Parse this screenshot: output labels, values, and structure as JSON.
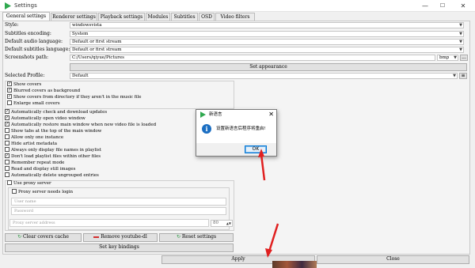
{
  "window": {
    "title": "Settings",
    "minimize": "—",
    "maximize": "☐",
    "close": "✕",
    "accent": "#e53935"
  },
  "tabs": [
    "General settings",
    "Renderer settings",
    "Playback settings",
    "Modules",
    "Subtitles",
    "OSD",
    "Video filters"
  ],
  "general": {
    "style_label": "Style:",
    "style_value": "windowsvista",
    "subtitles_encoding_label": "Subtitles encoding:",
    "subtitles_encoding_value": "System",
    "audio_lang_label": "Default audio language:",
    "audio_lang_value": "Default or first stream",
    "sub_lang_label": "Default subtitles language:",
    "sub_lang_value": "Default or first stream",
    "screenshots_label": "Screenshots path:",
    "screenshots_value": "C:/Users/qiyue/Pictures",
    "format_value": "bmp",
    "browse": "...",
    "set_appearance": "Set appearance",
    "profile_label": "Selected Profile:",
    "profile_value": "Default",
    "profile_menu": "≡"
  },
  "covers": [
    {
      "label": "Show covers",
      "checked": true
    },
    {
      "label": "Blurred covers as background",
      "checked": true
    },
    {
      "label": "Show covers from directory if they aren't in the music file",
      "checked": true
    },
    {
      "label": "Enlarge small covers",
      "checked": false
    }
  ],
  "options": [
    {
      "label": "Automatically check and download updates",
      "checked": true
    },
    {
      "label": "Automatically open video window",
      "checked": true
    },
    {
      "label": "Automatically restore main window when new video file is loaded",
      "checked": true
    },
    {
      "label": "Show tabs at the top of the main window",
      "checked": false
    },
    {
      "label": "Allow only one instance",
      "checked": false
    },
    {
      "label": "Hide artist metadata",
      "checked": false
    },
    {
      "label": "Always only display file names in playlist",
      "checked": false
    },
    {
      "label": "Don't load playlist files within other files",
      "checked": true
    },
    {
      "label": "Remember repeat mode",
      "checked": false
    },
    {
      "label": "Read and display still images",
      "checked": false
    },
    {
      "label": "Automatically delete ungrouped entries",
      "checked": false
    }
  ],
  "proxy": {
    "use_proxy": "Use proxy server",
    "needs_login": "Proxy server needs login",
    "username_placeholder": "User name",
    "password_placeholder": "Password",
    "address_placeholder": "Proxy server address",
    "port_value": "80"
  },
  "buttons": {
    "clear_covers": "Clear covers cache",
    "remove_youtube": "Remove youtube-dl",
    "reset_settings": "Reset settings",
    "set_key_bindings": "Set key bindings",
    "apply": "Apply",
    "close": "Close"
  },
  "dialog": {
    "title": "新语言",
    "message": "设置新语言后程序将重启!",
    "ok": "OK"
  },
  "colors": {
    "annotation_arrow": "#e02020",
    "dialog_button_border": "#0078d7",
    "info_icon": "#1b6ec2"
  }
}
